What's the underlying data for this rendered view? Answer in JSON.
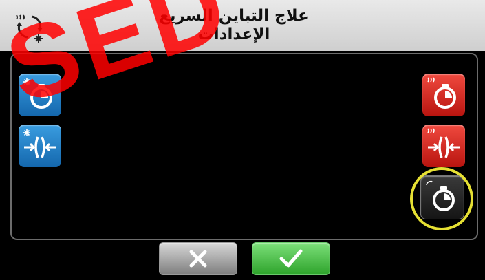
{
  "header": {
    "title_line1": "علاج التباين السريع",
    "title_line2": "الإعدادات",
    "mode_icon": "cycle-heat-cool-icon"
  },
  "watermark": {
    "text": "SED"
  },
  "panel": {
    "left_buttons": [
      {
        "name": "cool-timer-button",
        "icon": "snowflake-stopwatch-icon",
        "color": "#1e7fd0"
      },
      {
        "name": "cool-contrast-button",
        "icon": "snowflake-compress-icon",
        "color": "#1e7fd0"
      }
    ],
    "right_buttons": [
      {
        "name": "heat-timer-button",
        "icon": "heat-stopwatch-icon",
        "color": "#d8221a"
      },
      {
        "name": "heat-contrast-button",
        "icon": "heat-compress-icon",
        "color": "#d8221a"
      },
      {
        "name": "cycle-timer-button",
        "icon": "cycle-stopwatch-icon",
        "color": "#222222",
        "highlighted": true
      }
    ]
  },
  "footer": {
    "cancel_icon": "close-icon",
    "confirm_icon": "checkmark-icon"
  },
  "colors": {
    "highlight": "#e6e033",
    "header_bg": "#dcdcdc",
    "background": "#000000"
  }
}
